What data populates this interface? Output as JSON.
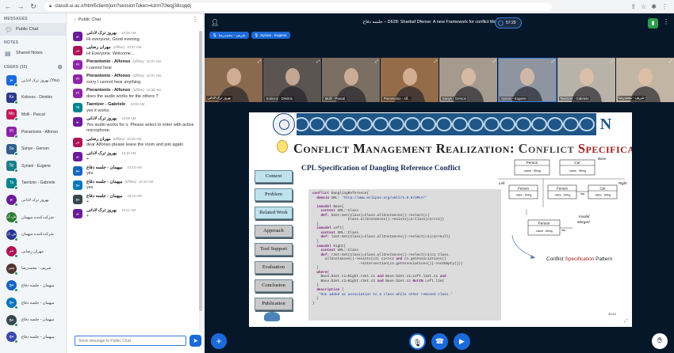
{
  "browser": {
    "url": "class8.ui.ac.ir/html5client/join?sessionToken=kzrm70leqjS8cqqdj"
  },
  "nav": {
    "messages_title": "MESSAGES",
    "public_chat": "Public Chat",
    "notes_title": "NOTES",
    "shared_notes": "Shared Notes",
    "users_title": "USERS (35)"
  },
  "users": [
    {
      "initials": "بو",
      "name": "بهروز ترک لادانی (You)",
      "color": "#1b6ad9",
      "round": false
    },
    {
      "initials": "Ko",
      "name": "Kolovos - Dimitris",
      "color": "#2b3a8c",
      "round": false
    },
    {
      "initials": "Mo",
      "name": "Molli - Pascal",
      "color": "#c2185b",
      "round": false
    },
    {
      "initials": "Pi",
      "name": "Pierantonio - Alfonso",
      "color": "#8e24aa",
      "round": false
    },
    {
      "initials": "Su",
      "name": "Sunye - Gerson",
      "color": "#2e5e8e",
      "round": false
    },
    {
      "initials": "Sy",
      "name": "Syriani - Eugene",
      "color": "#1a7f8a",
      "round": false
    },
    {
      "initials": "Ta",
      "name": "Taentzer - Gabriele",
      "color": "#00838f",
      "round": false
    },
    {
      "initials": "بو",
      "name": "بهروز ترک لادانی",
      "color": "#6a1b9a",
      "round": true
    },
    {
      "initials": "ش.ک",
      "name": "شرکت‌کننده میهمان",
      "color": "#2e7d32",
      "round": true
    },
    {
      "initials": "ش.ک",
      "name": "شرکت‌کننده میهمان",
      "color": "#283593",
      "round": true
    },
    {
      "initials": "مر",
      "name": "مهران رضایی",
      "color": "#ad1457",
      "round": true
    },
    {
      "initials": "شم",
      "name": "شریف - محمدرضا",
      "color": "#4e342e",
      "round": true
    },
    {
      "initials": "مج",
      "name": "میهمان - جلسه دفاع",
      "color": "#1565c0",
      "round": true
    },
    {
      "initials": "مج",
      "name": "میهمان - جلسه دفاع",
      "color": "#0277bd",
      "round": true
    },
    {
      "initials": "مج",
      "name": "میهمان - جلسه دفاع",
      "color": "#37474f",
      "round": true
    },
    {
      "initials": "مج",
      "name": "میهمان - جلسه دفاع",
      "color": "#3949ab",
      "round": true
    }
  ],
  "chat": {
    "header": "Public Chat",
    "input_placeholder": "Send message to Public Chat",
    "messages": [
      {
        "initials": "بو",
        "color": "#6a1b9a",
        "name": "بهروز ترک لادانی",
        "offline": "",
        "time": "10:06 AM",
        "text": "Hi everyone, Good evening."
      },
      {
        "initials": "مر",
        "color": "#ad1457",
        "name": "مهران رضایی",
        "offline": "(offline)",
        "time": "10:07 AM",
        "text": "Hi Everyone. Welcome..."
      },
      {
        "initials": "Pi",
        "color": "#8e24aa",
        "name": "Pierantonio - Alfonso",
        "offline": "(offline)",
        "time": "10:07 AM",
        "text": "I cannot hear"
      },
      {
        "initials": "Pi",
        "color": "#8e24aa",
        "name": "Pierantonio - Alfonso",
        "offline": "(offline)",
        "time": "10:07 AM",
        "text": "sorry I cannot hear anything"
      },
      {
        "initials": "Pi",
        "color": "#8e24aa",
        "name": "Pierantonio - Alfonso",
        "offline": "(offline)",
        "time": "10:08 AM",
        "text": "does the audio works for the others ?"
      },
      {
        "initials": "Ta",
        "color": "#00838f",
        "name": "Taentzer - Gabriele",
        "offline": "",
        "time": "10:08 AM",
        "text": "yes it works"
      },
      {
        "initials": "بو",
        "color": "#6a1b9a",
        "name": "بهروز ترک لادانی",
        "offline": "",
        "time": "10:08 AM",
        "text": "Yes audio works for u. Please select to enter with active microphone."
      },
      {
        "initials": "مر",
        "color": "#ad1457",
        "name": "مهران رضایی",
        "offline": "(offline)",
        "time": "10:09 AM",
        "text": "dear Alfonso please leave the room and join again"
      },
      {
        "initials": "بو",
        "color": "#6a1b9a",
        "name": "بهروز ترک لادانی",
        "offline": "",
        "time": "10:10 AM",
        "text": "+"
      },
      {
        "initials": "مج",
        "color": "#1565c0",
        "name": "میهمان - جلسه دفاع",
        "offline": "",
        "time": "10:10 AM",
        "text": "yes"
      },
      {
        "initials": "مج",
        "color": "#0277bd",
        "name": "میهمان - جلسه دفاع",
        "offline": "(offline)",
        "time": "10:10 AM",
        "text": "yes"
      },
      {
        "initials": "مج",
        "color": "#37474f",
        "name": "میهمان - جلسه دفاع",
        "offline": "",
        "time": "10:10 AM",
        "text": "+"
      },
      {
        "initials": "بو",
        "color": "#6a1b9a",
        "name": "بهروز ترک لادانی",
        "offline": "",
        "time": "10:11 AM",
        "text": "+"
      }
    ]
  },
  "presentation": {
    "title": "جلسه دفاع – D628: Sharbaf Dfense: A new Framework for conflict Management",
    "recording_time": "57:29",
    "tags": [
      "شریف - محمدرضا",
      "Syriani - Eugene"
    ],
    "videos": [
      {
        "name": "بهروز ترک لادانی",
        "bg": "#8a6a4f",
        "talking": false
      },
      {
        "name": "Kolovos - Dimitris",
        "bg": "#5c5450",
        "talking": false
      },
      {
        "name": "Molli - Pascal",
        "bg": "#7b6e62",
        "talking": false
      },
      {
        "name": "Pierantonio - Alf...",
        "bg": "#946c4a",
        "talking": false
      },
      {
        "name": "Sunye - Gerson",
        "bg": "#a49a8e",
        "talking": false
      },
      {
        "name": "Syriani - Eugene",
        "bg": "#8e95a0",
        "talking": true
      },
      {
        "name": "Taentzer - Gabriele",
        "bg": "#b9b2a8",
        "talking": false
      },
      {
        "name": "شریف - محمدرضا",
        "bg": "#c2b5a3",
        "talking": false
      }
    ]
  },
  "slide": {
    "title_main": "Conflict Management Realization:",
    "title_sub": "Conflict",
    "title_spec": "Specification",
    "subtitle": "CPL Specification of Dangling Reference Conflict",
    "buttons": [
      {
        "label": "Context",
        "gray": false
      },
      {
        "label": "Problem",
        "gray": false
      },
      {
        "label": "Related Work",
        "gray": false
      },
      {
        "label": "Approach",
        "gray": true
      },
      {
        "label": "Tool Support",
        "gray": true
      },
      {
        "label": "Evaluation",
        "gray": true
      },
      {
        "label": "Conclusion",
        "gray": true
      },
      {
        "label": "Publication",
        "gray": true
      }
    ],
    "code_lines": [
      "conflict DanglingReference{",
      "  domain UML: 'http://www.eclipse.org/uml2/5.0.0/UML#/'",
      "",
      "  inmodel Base{",
      "    context UML::Class",
      "    def: b2et:Set(Class)=Class.allInstances()->select(c|",
      "                 Class.allInstances()->exists(c2:Class|c1<>c2))",
      "  }",
      "  inmodel Left{",
      "    context UML::Class",
      "    def: l2et:Set(Class)=Class.allInstances()->select(c1|c1<>null)",
      "  }",
      "  inmodel Right{",
      "    context UML::Class",
      "    def: r2et:Set(Class)=Class.allInstances()->select(c1|c1 Class.",
      "      allInstances()->exists(c2| c1<>c2 and c1.getAssociations()",
      "                      ->intersection(c2.getAssociations())->notEmpty()))",
      "  }",
      "  where{",
      "    Base.b2et.c1=Right.r2et.c1 and Base.b2et.c1=Left.l2et.c1 and",
      "    Base.b2et.c2=Right.r2et.c2 and Base.b2et.c2 NotIN Left.l2et",
      "  }",
      "  description {",
      "   'One added an association to a class while other removed class.'",
      "  }",
      "}"
    ],
    "diagram": {
      "base_label": "Base",
      "left_label": "Left",
      "right_label": "Right",
      "person": "Person",
      "car": "Car",
      "attr": "-name : String",
      "has": "has",
      "invalid": "Invalid",
      "merged": "Merged"
    },
    "pattern_word1": "Conflict",
    "pattern_spec": "Specification",
    "pattern_word2": "Pattern",
    "page_number": "30/44"
  }
}
